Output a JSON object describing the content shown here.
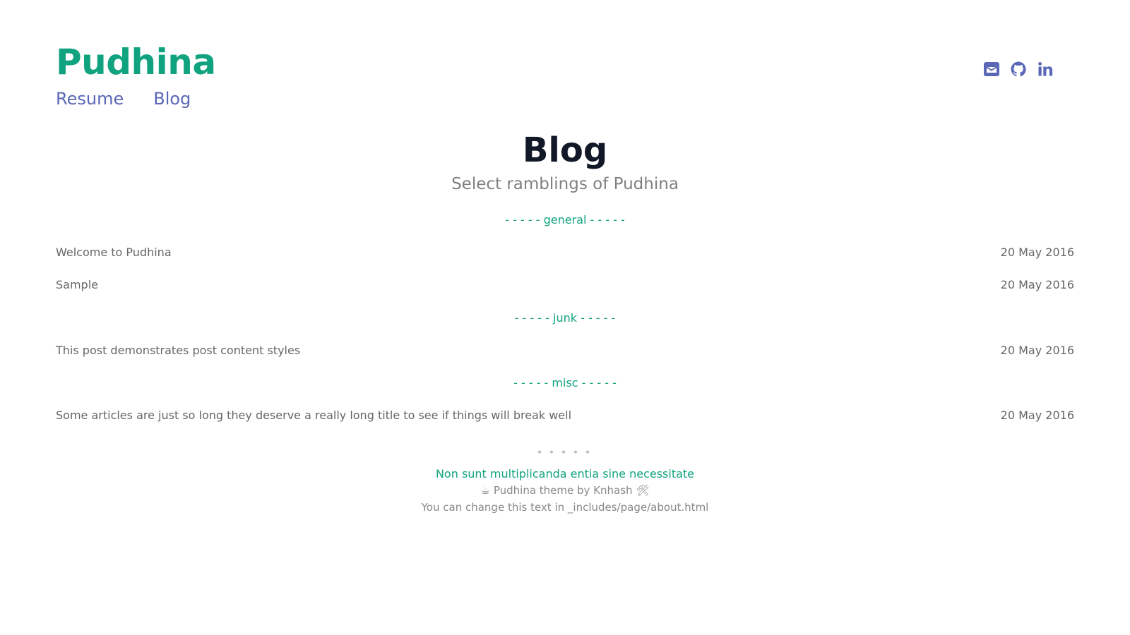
{
  "header": {
    "site_title": "Pudhina",
    "nav": [
      {
        "label": "Resume"
      },
      {
        "label": "Blog"
      }
    ],
    "social_icons": [
      "envelope-icon",
      "github-icon",
      "linkedin-icon"
    ],
    "accent_color": "#11a37f",
    "link_color": "#5a67b6"
  },
  "main": {
    "heading": "Blog",
    "subheading": "Select ramblings of Pudhina",
    "categories": [
      {
        "label": "- - - - - general - - - - -",
        "posts": [
          {
            "title": "Welcome to Pudhina",
            "date": "20 May 2016"
          },
          {
            "title": "Sample",
            "date": "20 May 2016"
          }
        ]
      },
      {
        "label": "- - - - - junk - - - - -",
        "posts": [
          {
            "title": "This post demonstrates post content styles",
            "date": "20 May 2016"
          }
        ]
      },
      {
        "label": "- - - - - misc - - - - -",
        "posts": [
          {
            "title": "Some articles are just so long they deserve a really long title to see if things will break well",
            "date": "20 May 2016"
          }
        ]
      }
    ]
  },
  "footer": {
    "stars": "* * * * *",
    "quote": "Non sunt multiplicanda entia sine necessitate",
    "credit": "☕ Pudhina theme by Knhash 🛠",
    "note": "You can change this text in _includes/page/about.html"
  }
}
